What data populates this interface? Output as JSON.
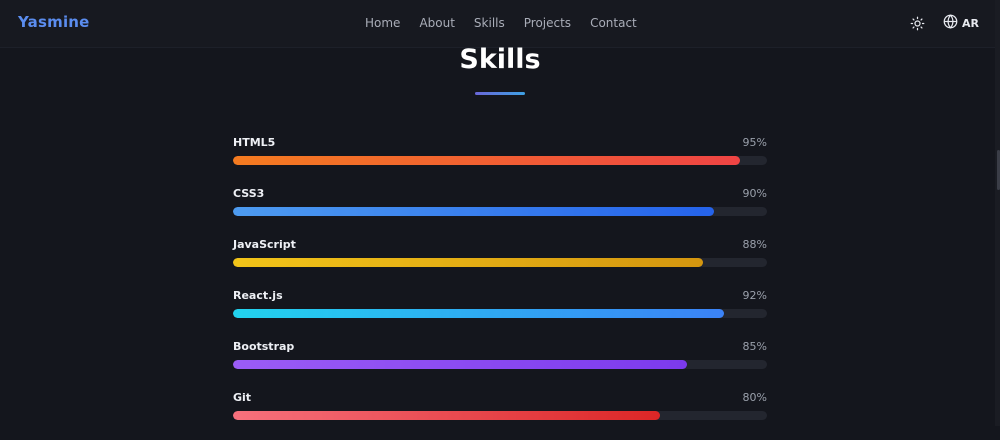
{
  "nav": {
    "brand": "Yasmine",
    "links": [
      "Home",
      "About",
      "Skills",
      "Projects",
      "Contact"
    ],
    "theme_icon": "sun-icon",
    "lang_icon": "globe-icon",
    "lang_label": "AR"
  },
  "section": {
    "title": "Skills"
  },
  "skills": [
    {
      "name": "HTML5",
      "percent_label": "95%",
      "level": 0.95,
      "color_start": "#f47b20",
      "color_end": "#ef4444"
    },
    {
      "name": "CSS3",
      "percent_label": "90%",
      "level": 0.9,
      "color_start": "#4d9bf0",
      "color_end": "#2563eb"
    },
    {
      "name": "JavaScript",
      "percent_label": "88%",
      "level": 0.88,
      "color_start": "#f2c419",
      "color_end": "#d4960f"
    },
    {
      "name": "React.js",
      "percent_label": "92%",
      "level": 0.92,
      "color_start": "#22d3ee",
      "color_end": "#3b82f6"
    },
    {
      "name": "Bootstrap",
      "percent_label": "85%",
      "level": 0.85,
      "color_start": "#9b5cf6",
      "color_end": "#7c3aed"
    },
    {
      "name": "Git",
      "percent_label": "80%",
      "level": 0.8,
      "color_start": "#f7717d",
      "color_end": "#dc2626"
    }
  ],
  "colors": {
    "background": "#14161d",
    "accent": "#5b8def",
    "track": "#23262f"
  }
}
